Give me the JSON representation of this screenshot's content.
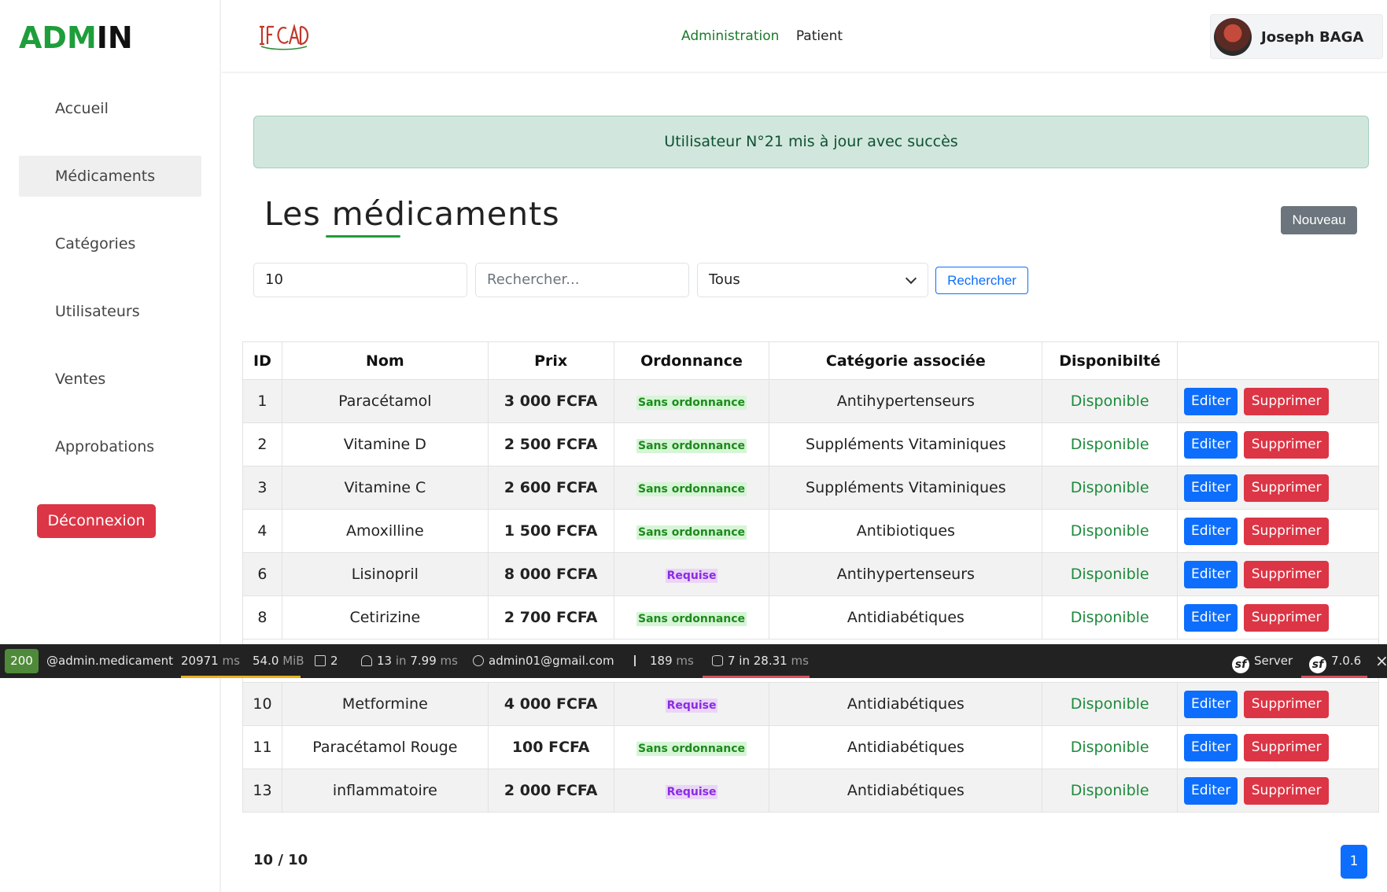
{
  "sidebar": {
    "brand_part1": "ADM",
    "brand_part2": "IN",
    "items": [
      {
        "label": "Accueil"
      },
      {
        "label": "Médicaments"
      },
      {
        "label": "Catégories"
      },
      {
        "label": "Utilisateurs"
      },
      {
        "label": "Ventes"
      },
      {
        "label": "Approbations"
      }
    ],
    "logout_label": "Déconnexion"
  },
  "header": {
    "logo_icon": "ifcad-logo",
    "nav": {
      "administration": "Administration",
      "patient": "Patient"
    },
    "user_name": "Joseph BAGA"
  },
  "alert": {
    "message": "Utilisateur N°21 mis à jour avec succès"
  },
  "main": {
    "title": "Les médicaments",
    "new_button": "Nouveau",
    "filters": {
      "per_page_value": "10",
      "search_placeholder": "Rechercher...",
      "category_selected": "Tous",
      "search_button": "Rechercher"
    }
  },
  "table": {
    "headers": [
      "ID",
      "Nom",
      "Prix",
      "Ordonnance",
      "Catégorie associée",
      "Disponibilté",
      ""
    ],
    "rows": [
      {
        "id": "1",
        "nom": "Paracétamol",
        "prix": "3 000 FCFA",
        "ordonnance": "Sans ordonnance",
        "categorie": "Antihypertenseurs",
        "dispo": "Disponible"
      },
      {
        "id": "2",
        "nom": "Vitamine D",
        "prix": "2 500 FCFA",
        "ordonnance": "Sans ordonnance",
        "categorie": "Suppléments Vitaminiques",
        "dispo": "Disponible"
      },
      {
        "id": "3",
        "nom": "Vitamine C",
        "prix": "2 600 FCFA",
        "ordonnance": "Sans ordonnance",
        "categorie": "Suppléments Vitaminiques",
        "dispo": "Disponible"
      },
      {
        "id": "4",
        "nom": "Amoxilline",
        "prix": "1 500 FCFA",
        "ordonnance": "Sans ordonnance",
        "categorie": "Antibiotiques",
        "dispo": "Disponible"
      },
      {
        "id": "6",
        "nom": "Lisinopril",
        "prix": "8 000 FCFA",
        "ordonnance": "Requise",
        "categorie": "Antihypertenseurs",
        "dispo": "Disponible"
      },
      {
        "id": "8",
        "nom": "Cetirizine",
        "prix": "2 700 FCFA",
        "ordonnance": "Sans ordonnance",
        "categorie": "Antidiabétiques",
        "dispo": "Disponible"
      },
      {
        "id": "10",
        "nom": "Metformine",
        "prix": "4 000 FCFA",
        "ordonnance": "Requise",
        "categorie": "Antidiabétiques",
        "dispo": "Disponible"
      },
      {
        "id": "11",
        "nom": "Paracétamol Rouge",
        "prix": "100 FCFA",
        "ordonnance": "Sans ordonnance",
        "categorie": "Antidiabétiques",
        "dispo": "Disponible"
      },
      {
        "id": "13",
        "nom": "inflammatoire",
        "prix": "2 000 FCFA",
        "ordonnance": "Requise",
        "categorie": "Antidiabétiques",
        "dispo": "Disponible"
      }
    ],
    "edit_label": "Editer",
    "delete_label": "Supprimer"
  },
  "debug_toolbar": {
    "status": "200",
    "route": "@admin.medicament",
    "time": "20971",
    "time_unit": "ms",
    "memory": "54.0",
    "memory_unit": "MiB",
    "forms": "2",
    "cache_count": "13",
    "cache_in": "in",
    "cache_time": "7.99",
    "cache_unit": "ms",
    "user": "admin01@gmail.com",
    "twig_time": "189",
    "twig_unit": "ms",
    "db": "7 in 28.31",
    "db_unit": "ms",
    "server": "Server",
    "version": "7.0.6",
    "close": "×"
  },
  "pagination": {
    "count": "10 / 10",
    "current_page": "1"
  }
}
